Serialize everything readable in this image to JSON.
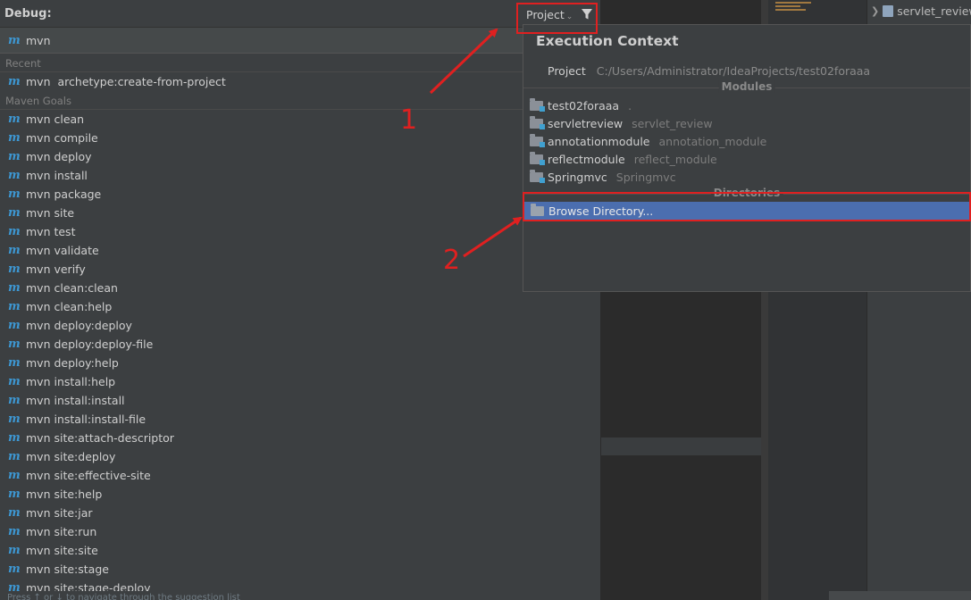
{
  "debug_popup": {
    "title": "Debug:",
    "scope_label": "Project",
    "search_value": "mvn",
    "recent_label": "Recent",
    "recent_items": [
      {
        "cmd": "mvn",
        "arg": "archetype:create-from-project"
      }
    ],
    "goals_label": "Maven Goals",
    "goals": [
      "mvn clean",
      "mvn compile",
      "mvn deploy",
      "mvn install",
      "mvn package",
      "mvn site",
      "mvn test",
      "mvn validate",
      "mvn verify",
      "mvn clean:clean",
      "mvn clean:help",
      "mvn deploy:deploy",
      "mvn deploy:deploy-file",
      "mvn deploy:help",
      "mvn install:help",
      "mvn install:install",
      "mvn install:install-file",
      "mvn site:attach-descriptor",
      "mvn site:deploy",
      "mvn site:effective-site",
      "mvn site:help",
      "mvn site:jar",
      "mvn site:run",
      "mvn site:site",
      "mvn site:stage",
      "mvn site:stage-deploy"
    ],
    "status_hint": "Press ↑ or ↓ to navigate through the suggestion list"
  },
  "exec_context": {
    "title": "Execution Context",
    "project_key": "Project",
    "project_path": "C:/Users/Administrator/IdeaProjects/test02foraaa",
    "modules_label": "Modules",
    "modules": [
      {
        "name": "test02foraaa",
        "alt": "."
      },
      {
        "name": "servletreview",
        "alt": "servlet_review"
      },
      {
        "name": "annotationmodule",
        "alt": "annotation_module"
      },
      {
        "name": "reflectmodule",
        "alt": "reflect_module"
      },
      {
        "name": "Springmvc",
        "alt": "Springmvc"
      }
    ],
    "directories_label": "Directories",
    "browse_label": "Browse Directory..."
  },
  "background": {
    "tree_item": "servlet_review"
  },
  "annotations": {
    "label_1": "1",
    "label_2": "2"
  },
  "colors": {
    "accent_selection": "#4b6eaf",
    "annotation_red": "#e02020",
    "maven_icon": "#3d97d2"
  }
}
